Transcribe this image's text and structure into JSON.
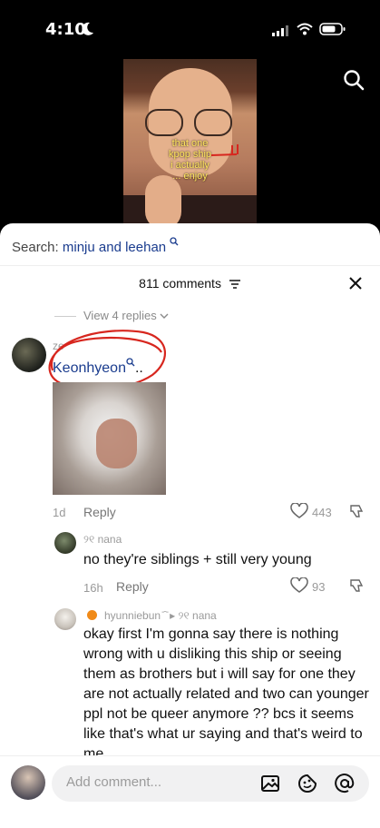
{
  "status_bar": {
    "time": "4:10"
  },
  "video": {
    "caption_lines": [
      "that one",
      "kpop ship",
      "i actually",
      "... enjoy"
    ]
  },
  "search": {
    "label": "Search:",
    "query": "minju and leehan"
  },
  "comments_header": {
    "count": "811 comments"
  },
  "thread": {
    "view_replies": "View 4 replies",
    "comment": {
      "username": "ze",
      "mention": "Keonhyeon",
      "mention_suffix": "..",
      "age": "1d",
      "reply": "Reply",
      "likes": "443"
    },
    "reply1": {
      "username": "nana",
      "username_prefix": "୨୧",
      "text": "no they're siblings + still very young",
      "age": "16h",
      "reply": "Reply",
      "likes": "93"
    },
    "reply2": {
      "username": "hyunniebun",
      "username_suffix": "᷄ ᷅",
      "arrow": "▸",
      "reply_to": "୨୧ nana",
      "text": "okay first I'm gonna say there is nothing wrong with u disliking this ship or seeing them as brothers but i will say for one they are not actually related and two can younger ppl not be queer anymore ?? bcs it seems like that's what ur saying and that's weird to me"
    }
  },
  "composer": {
    "placeholder": "Add comment..."
  },
  "icons": [
    "moon-icon",
    "signal-icon",
    "wifi-icon",
    "battery-icon",
    "search-icon",
    "filter-icon",
    "close-icon",
    "chevron-down-icon",
    "heart-icon",
    "dislike-icon",
    "image-icon",
    "emoji-icon",
    "mention-icon"
  ],
  "colors": {
    "link": "#1a3c8e",
    "annotation_red": "#d7261e",
    "caption_yellow": "#ffe45c"
  }
}
